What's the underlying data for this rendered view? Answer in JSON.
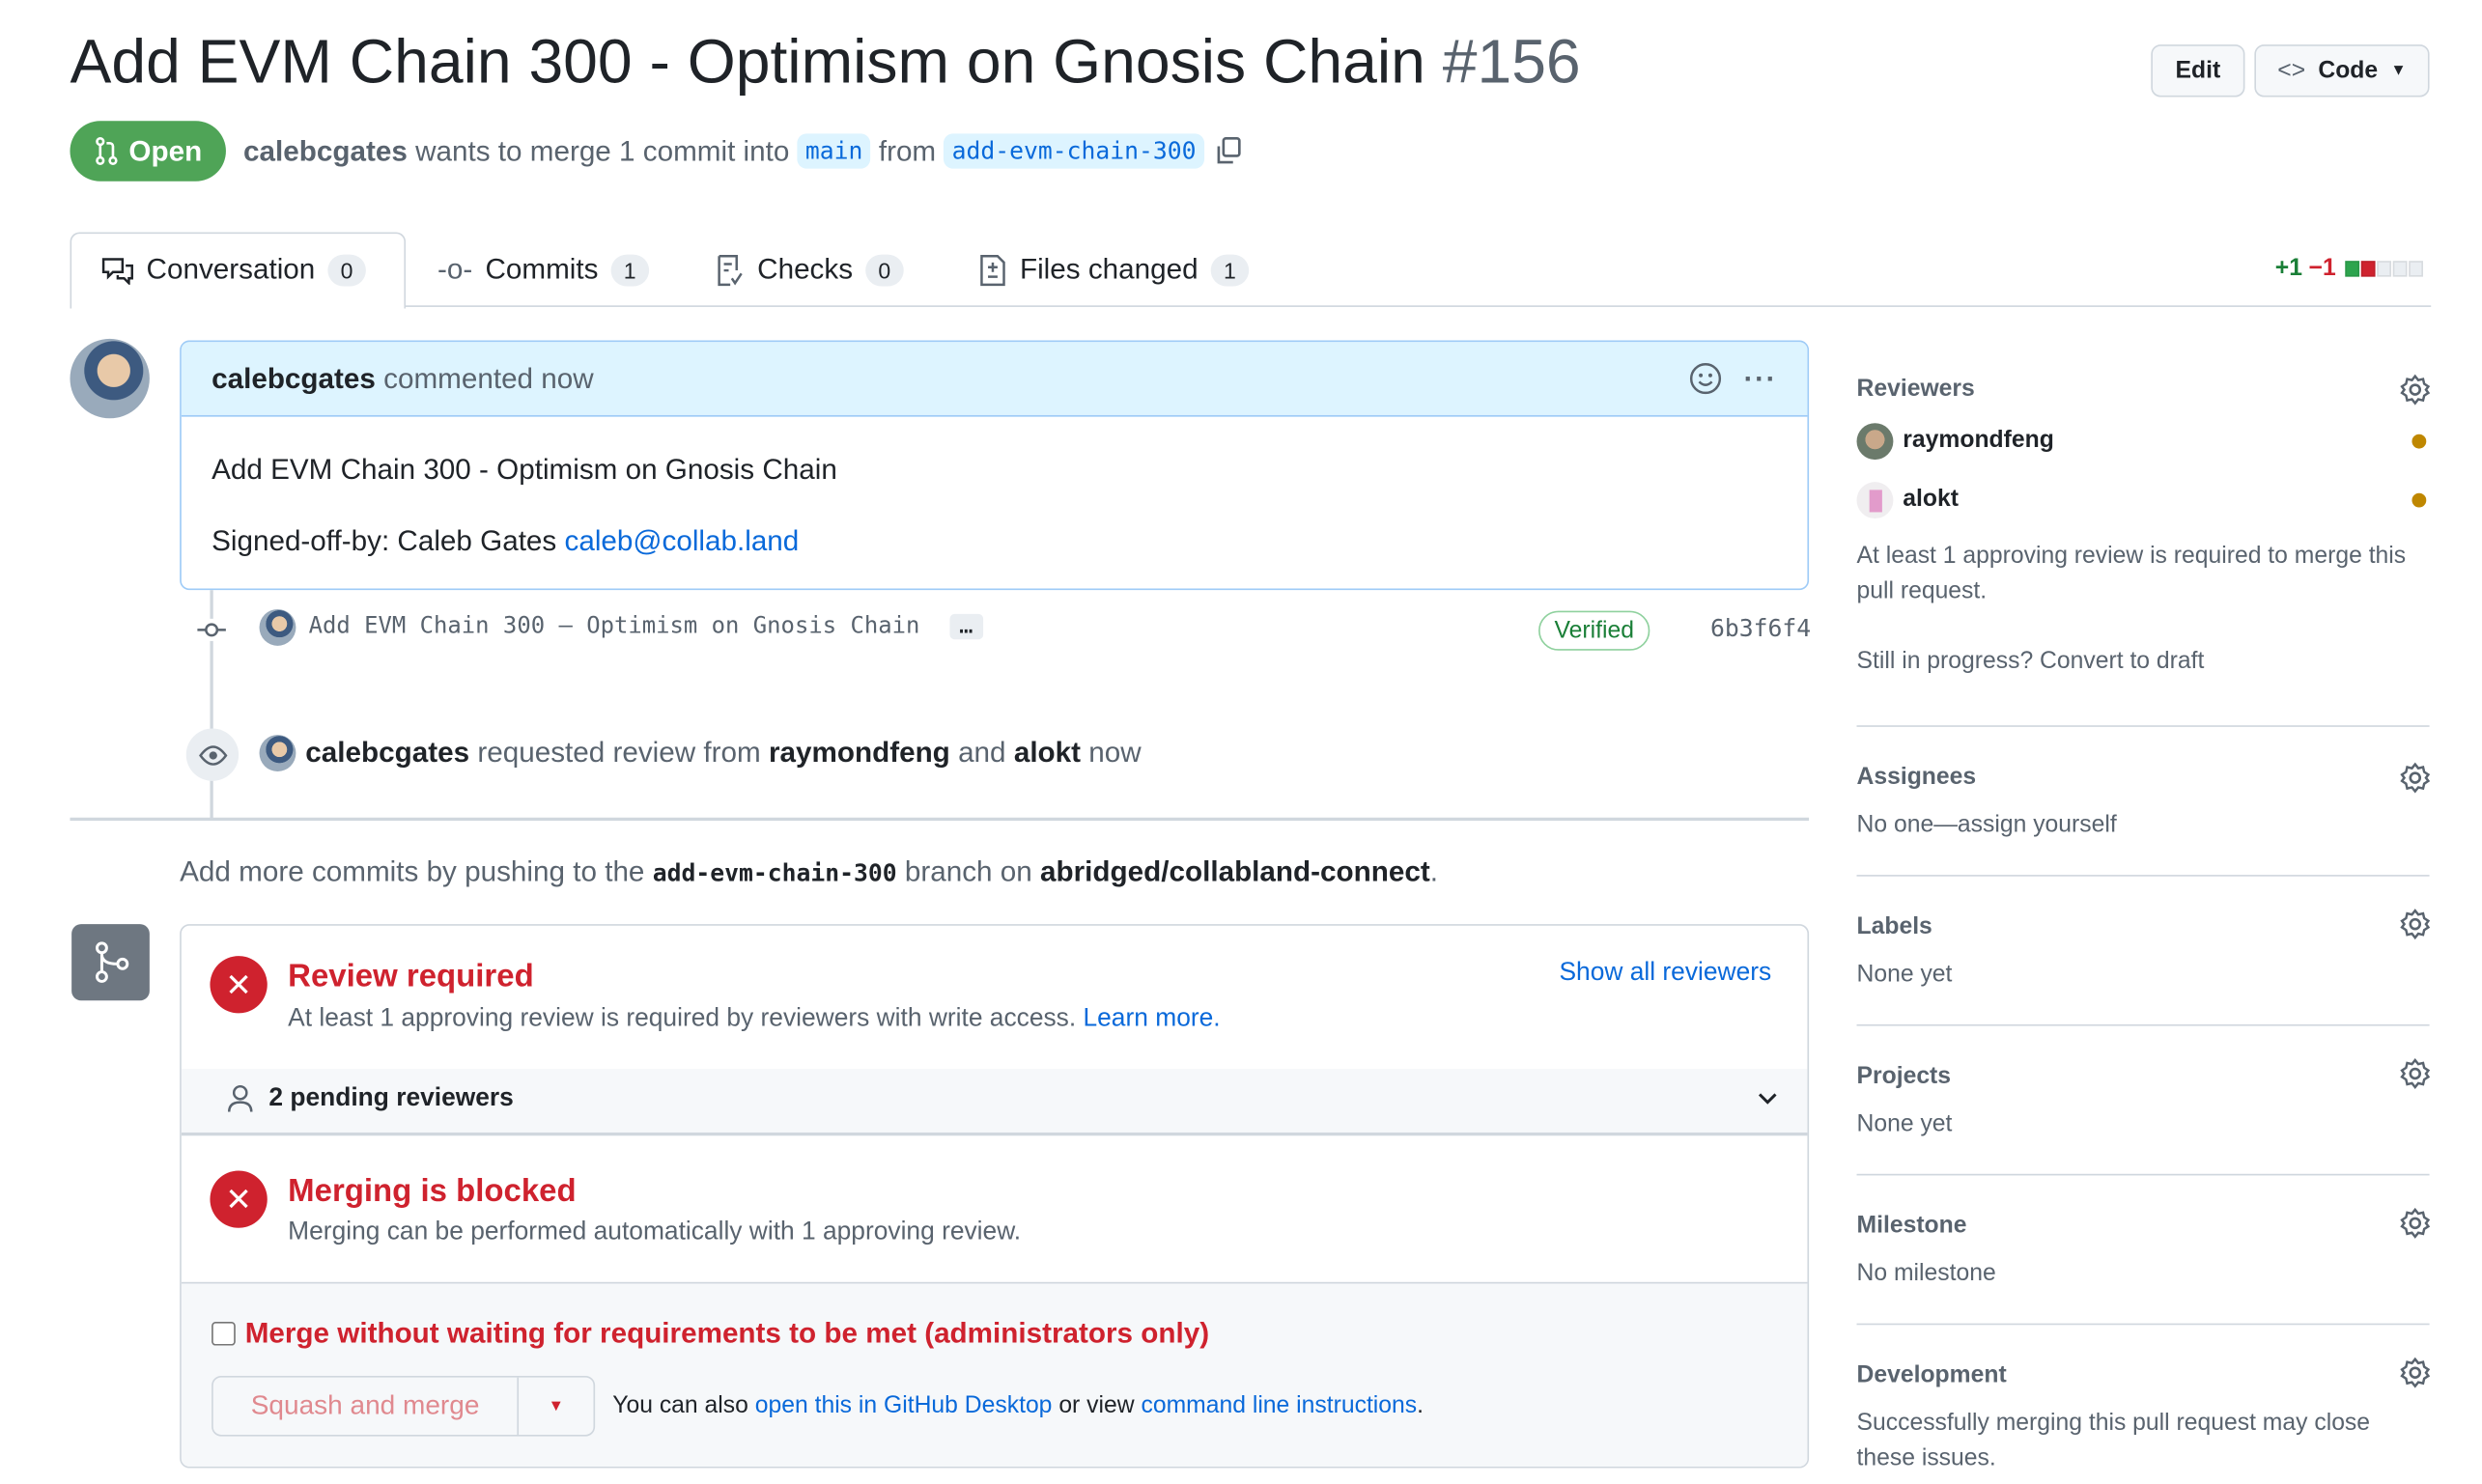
{
  "header": {
    "title": "Add EVM Chain 300 - Optimism on Gnosis Chain",
    "number": "#156",
    "edit_label": "Edit",
    "code_label": "Code",
    "status": "Open",
    "author": "calebcgates",
    "merge_text": "wants to merge 1 commit into",
    "base_branch": "main",
    "from_text": "from",
    "head_branch": "add-evm-chain-300"
  },
  "tabs": [
    {
      "label": "Conversation",
      "count": "0"
    },
    {
      "label": "Commits",
      "count": "1"
    },
    {
      "label": "Checks",
      "count": "0"
    },
    {
      "label": "Files changed",
      "count": "1"
    }
  ],
  "diffstat": {
    "additions": "+1",
    "deletions": "−1",
    "blocks": [
      "added",
      "removed",
      "neutral",
      "neutral",
      "neutral"
    ],
    "colors": {
      "added": "#2da44e",
      "removed": "#cf222e",
      "neutral": "#eaeef2"
    }
  },
  "comment": {
    "author": "calebcgates",
    "action": "commented now",
    "body_line1": "Add EVM Chain 300 - Optimism on Gnosis Chain",
    "signed_prefix": "Signed-off-by: Caleb Gates",
    "email": "caleb@collab.land"
  },
  "commit": {
    "message": "Add EVM Chain 300 – Optimism on Gnosis Chain",
    "ellipsis": "…",
    "verified": "Verified",
    "sha": "6b3f6f4"
  },
  "review_request": {
    "actor": "calebcgates",
    "text1": "requested review from",
    "reviewer1": "raymondfeng",
    "text2": "and",
    "reviewer2": "alokt",
    "time": "now"
  },
  "push_hint": {
    "prefix": "Add more commits by pushing to the",
    "branch": "add-evm-chain-300",
    "middle": "branch on",
    "repo": "abridged/collabland-connect",
    "suffix": "."
  },
  "merge_box": {
    "review_title": "Review required",
    "review_desc": "At least 1 approving review is required by reviewers with write access.",
    "learn_more": "Learn more.",
    "show_all": "Show all reviewers",
    "pending": "2 pending reviewers",
    "blocked_title": "Merging is blocked",
    "blocked_desc": "Merging can be performed automatically with 1 approving review.",
    "admin_checkbox": "Merge without waiting for requirements to be met (administrators only)",
    "admin_checked": false,
    "squash_label": "Squash and merge",
    "also_prefix": "You can also",
    "desktop_link": "open this in GitHub Desktop",
    "or_view": "or view",
    "cli_link": "command line instructions",
    "end": "."
  },
  "sidebar": {
    "reviewers": {
      "title": "Reviewers",
      "items": [
        {
          "name": "raymondfeng",
          "status": "pending"
        },
        {
          "name": "alokt",
          "status": "pending"
        }
      ],
      "note": "At least 1 approving review is required to merge this pull request.",
      "draft": "Still in progress? Convert to draft",
      "pending_color": "#bf8700"
    },
    "assignees": {
      "title": "Assignees",
      "value": "No one—assign yourself"
    },
    "labels": {
      "title": "Labels",
      "value": "None yet"
    },
    "projects": {
      "title": "Projects",
      "value": "None yet"
    },
    "milestone": {
      "title": "Milestone",
      "value": "No milestone"
    },
    "development": {
      "title": "Development",
      "value": "Successfully merging this pull request may close these issues."
    }
  }
}
